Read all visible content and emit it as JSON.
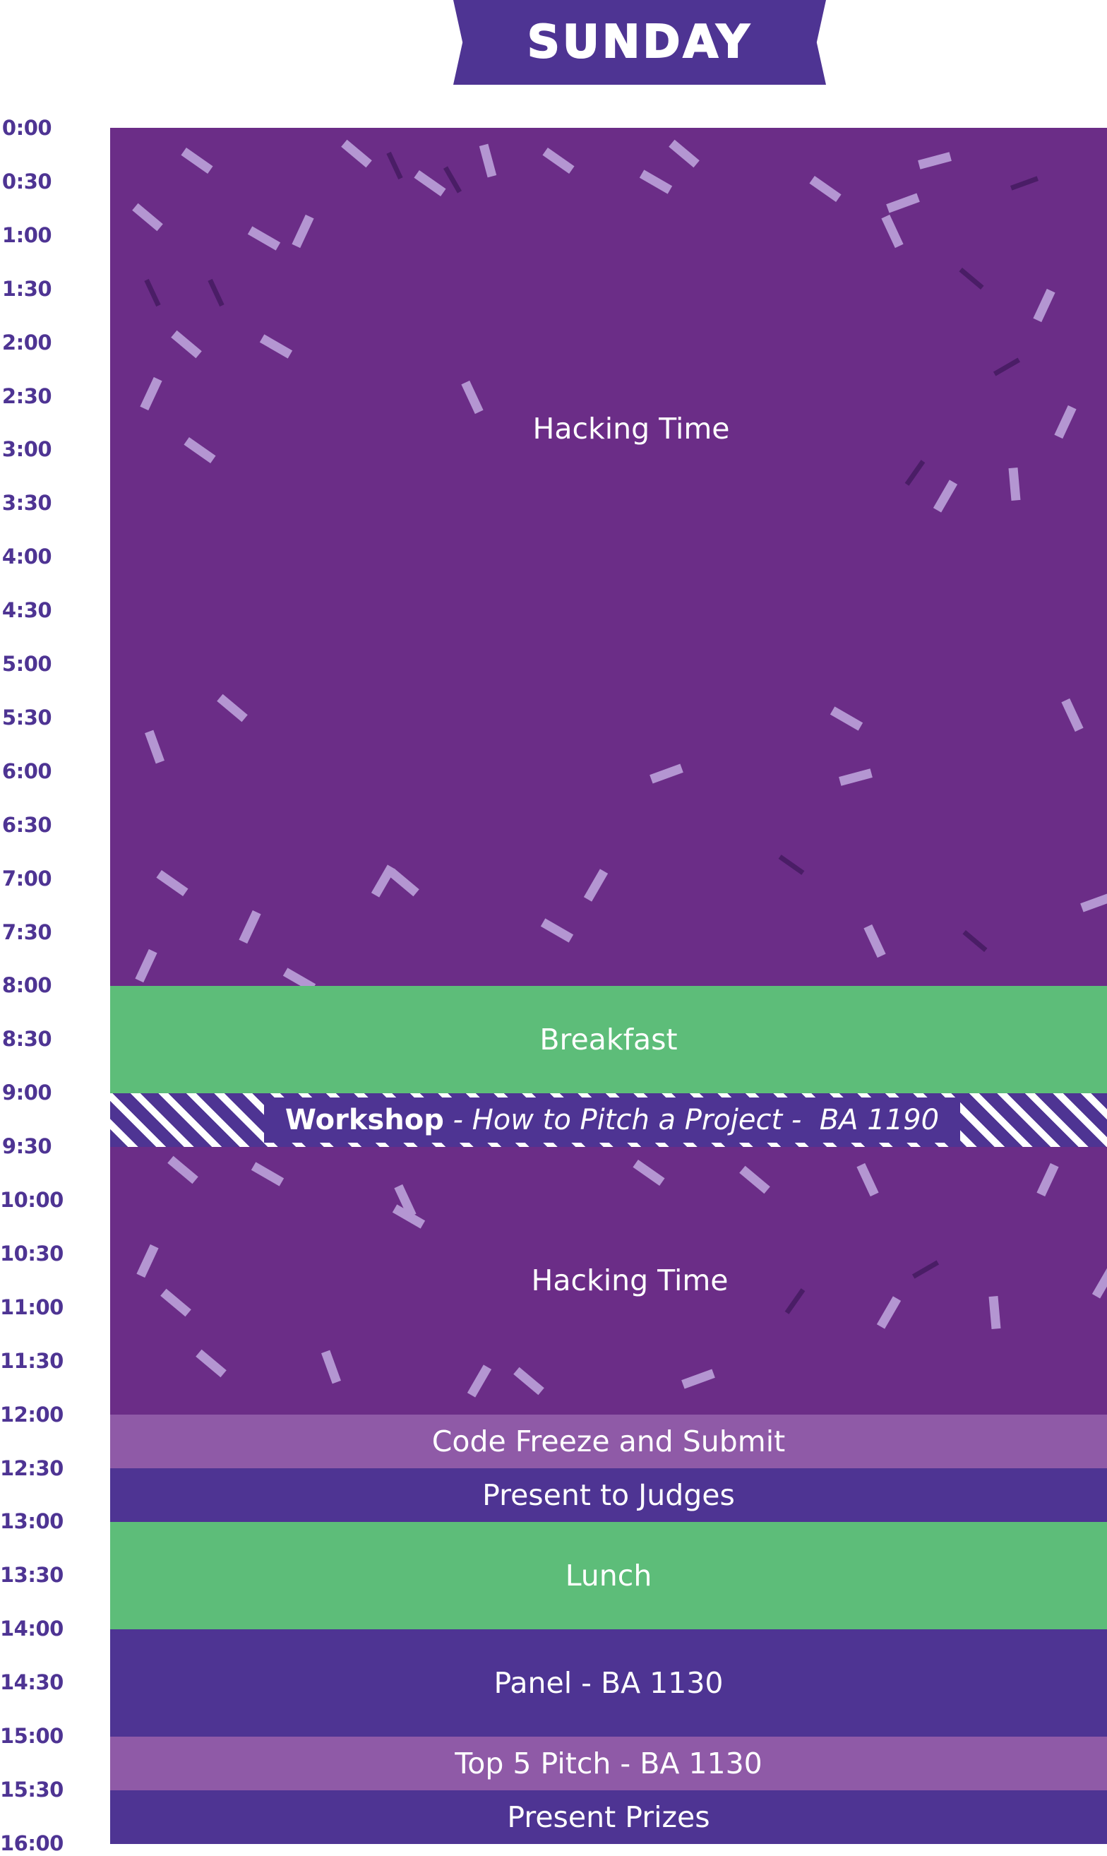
{
  "header": {
    "day_title": "SUNDAY"
  },
  "colors": {
    "hacking": "#6b2d87",
    "meal": "#5dbd79",
    "indigo": "#4e3493",
    "lilac": "#8f5aa7",
    "confetti_light": "#b496d2",
    "confetti_dark": "#4a1d66",
    "label_text": "#4e3493"
  },
  "time_labels": [
    "0:00",
    "0:30",
    "1:00",
    "1:30",
    "2:00",
    "2:30",
    "3:00",
    "3:30",
    "4:00",
    "4:30",
    "5:00",
    "5:30",
    "6:00",
    "6:30",
    "7:00",
    "7:30",
    "8:00",
    "8:30",
    "9:00",
    "9:30",
    "10:00",
    "10:30",
    "11:00",
    "11:30",
    "12:00",
    "12:30",
    "13:00",
    "13:30",
    "14:00",
    "14:30",
    "15:00",
    "15:30",
    "16:00"
  ],
  "events": {
    "hacking_1": {
      "label": "Hacking Time",
      "start": "0:00",
      "end": "8:00"
    },
    "breakfast": {
      "label": "Breakfast",
      "start": "8:00",
      "end": "9:00"
    },
    "workshop": {
      "title": "Workshop",
      "detail": " - How to Pitch a Project -  BA 1190",
      "start": "9:00",
      "end": "9:30"
    },
    "hacking_2": {
      "label": "Hacking Time",
      "start": "9:30",
      "end": "12:00"
    },
    "code_freeze": {
      "label": "Code Freeze and Submit",
      "start": "12:00",
      "end": "12:30"
    },
    "present_judges": {
      "label": "Present to Judges",
      "start": "12:30",
      "end": "13:00"
    },
    "lunch": {
      "label": "Lunch",
      "start": "13:00",
      "end": "14:00"
    },
    "panel": {
      "label": "Panel - BA 1130",
      "start": "14:00",
      "end": "15:00"
    },
    "top5": {
      "label": "Top 5 Pitch - BA 1130",
      "start": "15:00",
      "end": "15:30"
    },
    "prizes": {
      "label": "Present Prizes",
      "start": "15:30",
      "end": "16:00"
    }
  }
}
